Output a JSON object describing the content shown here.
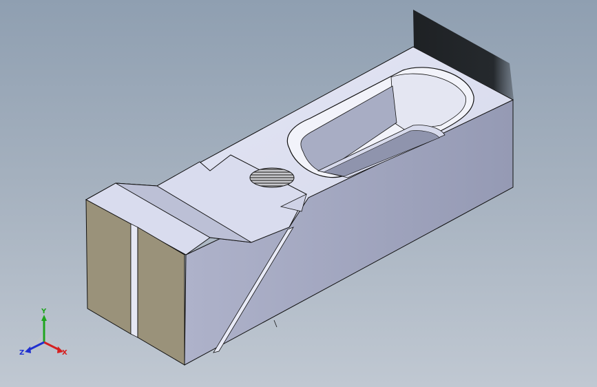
{
  "viewport": {
    "background_top": "#8f9fb1",
    "background_bottom": "#c0c8d2"
  },
  "model": {
    "face_color_top": "#dcdff0",
    "face_color_side": "#9ea3bd",
    "face_color_front": "#9a927a",
    "edge_color": "#101010",
    "shadow_color": "#1e2124",
    "hatch_icon": "thread-hatch"
  },
  "triad": {
    "x_label": "X",
    "y_label": "Y",
    "z_label": "Z",
    "x_color": "#d62020",
    "y_color": "#1fa51f",
    "z_color": "#2030d0"
  }
}
